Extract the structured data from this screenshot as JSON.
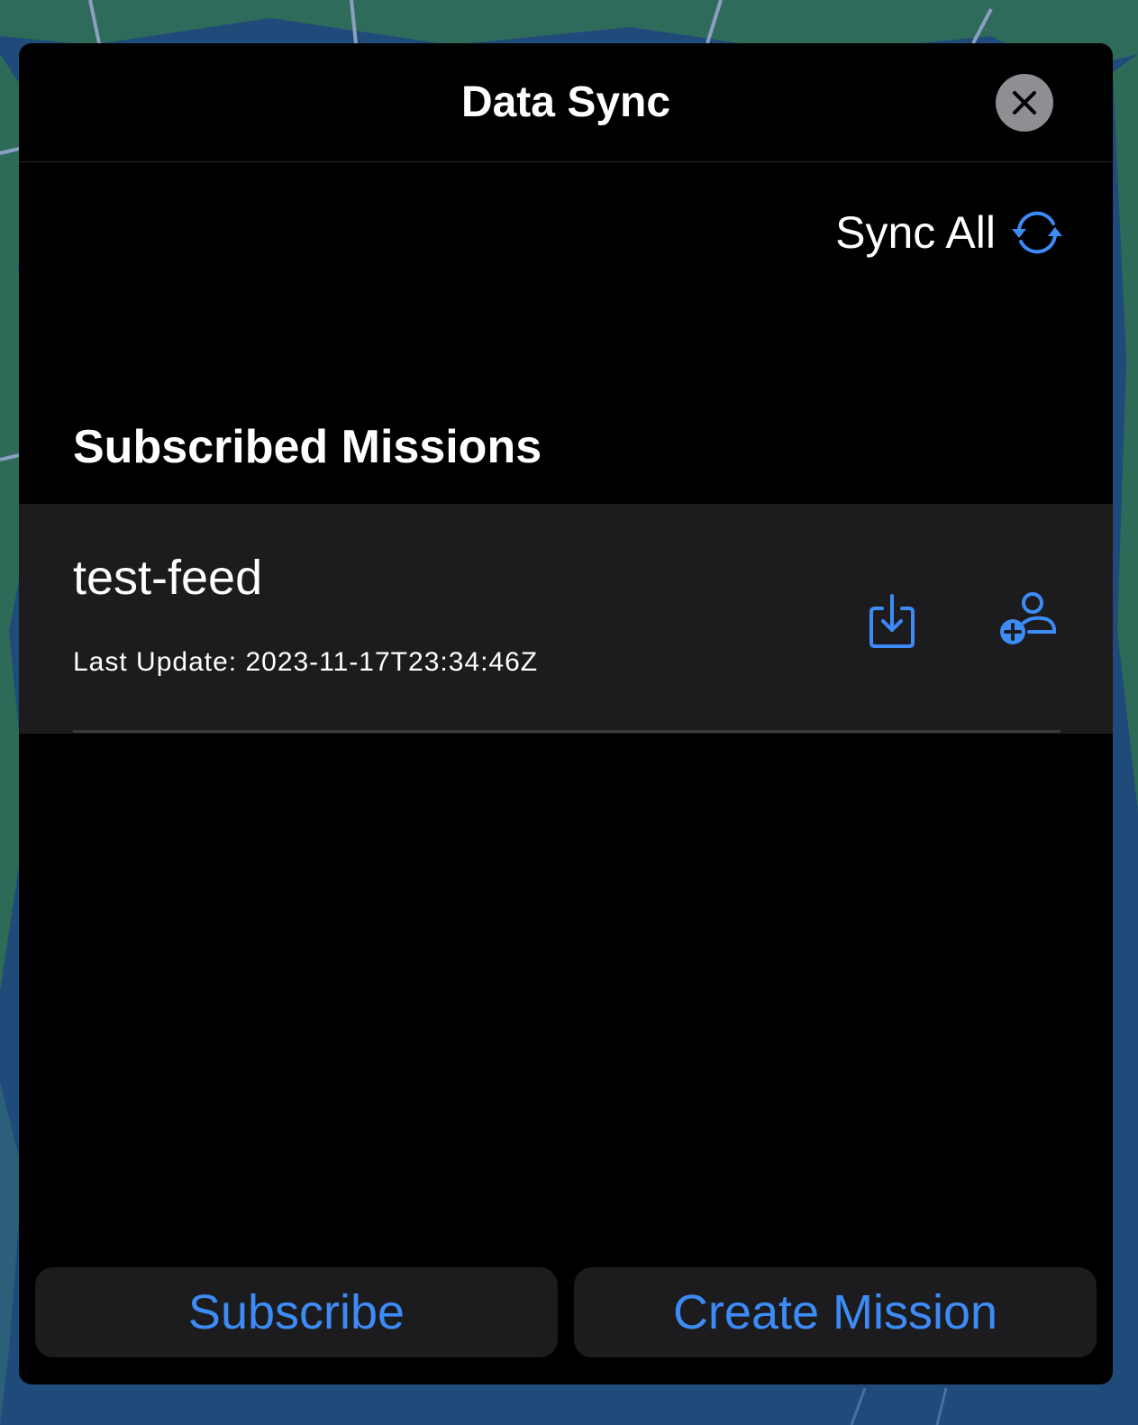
{
  "modal": {
    "title": "Data Sync",
    "sync_all_label": "Sync All",
    "section_title": "Subscribed Missions"
  },
  "missions": [
    {
      "name": "test-feed",
      "last_update": "Last Update: 2023-11-17T23:34:46Z",
      "actions": [
        "download-icon",
        "add-user-icon"
      ]
    }
  ],
  "footer": {
    "subscribe_label": "Subscribe",
    "create_mission_label": "Create Mission"
  },
  "colors": {
    "accent": "#3d8bf7",
    "modal_bg": "#000000",
    "row_bg": "#1c1c1e",
    "close_bg": "#8e8e93"
  }
}
